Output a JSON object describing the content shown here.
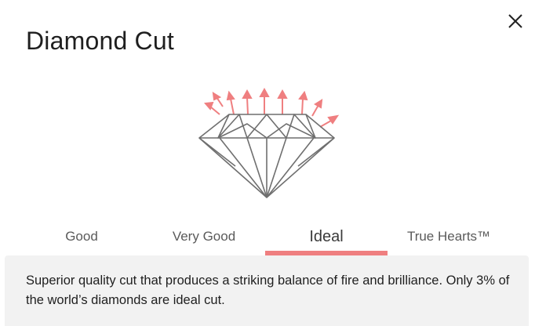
{
  "modal": {
    "title": "Diamond Cut",
    "close_icon": "close-icon"
  },
  "illustration": {
    "icon": "diamond-icon",
    "diamond_color": "#6f6f6f",
    "arrow_color": "#ef7f80"
  },
  "tabs": [
    {
      "label": "Good",
      "active": false
    },
    {
      "label": "Very Good",
      "active": false
    },
    {
      "label": "Ideal",
      "active": true
    },
    {
      "label": "True Hearts™",
      "active": false
    }
  ],
  "description": "Superior quality cut that produces a striking balance of fire and brilliance. Only 3% of the world’s diamonds are ideal cut.",
  "colors": {
    "accent": "#ef7f80",
    "panel_bg": "#f2f2f2"
  }
}
